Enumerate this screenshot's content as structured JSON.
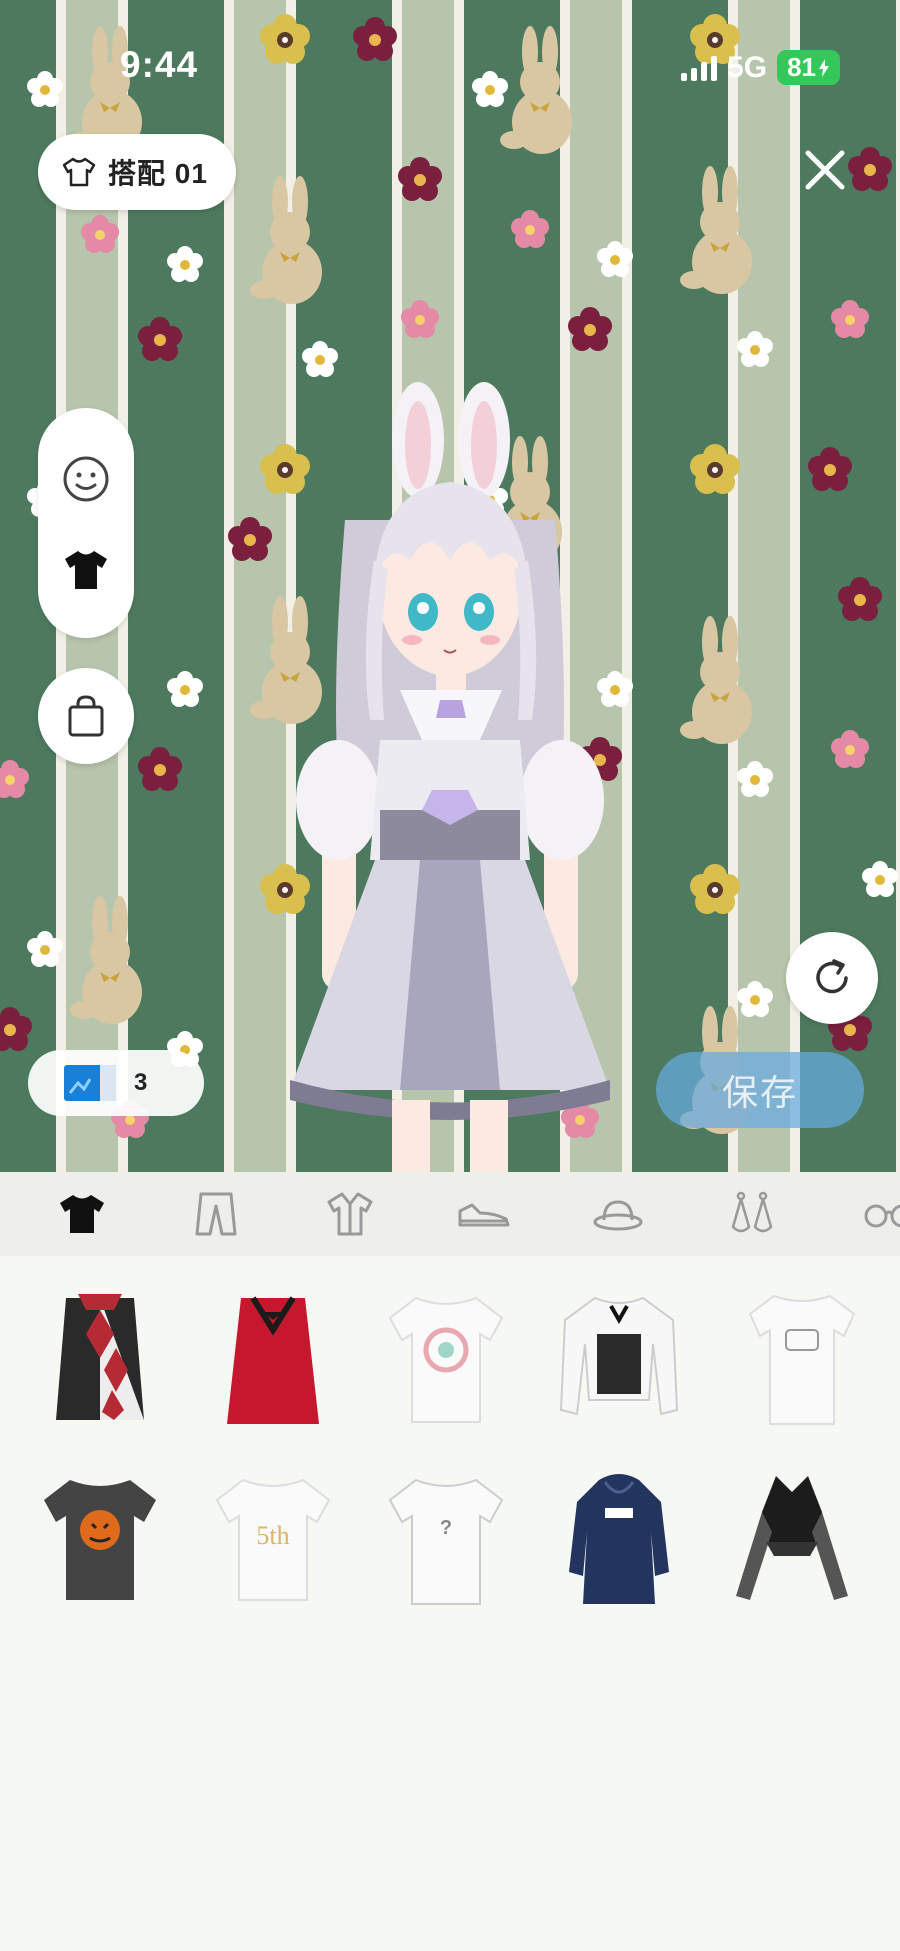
{
  "status_bar": {
    "time": "9:44",
    "network": "5G",
    "battery": "81"
  },
  "outfit": {
    "label": "搭配 01"
  },
  "tickets": {
    "count": "3"
  },
  "save_button": {
    "label": "保存"
  },
  "categories": [
    {
      "id": "tops",
      "icon": "tshirt-icon",
      "selected": true
    },
    {
      "id": "bottoms",
      "icon": "pants-icon",
      "selected": false
    },
    {
      "id": "outerwear",
      "icon": "jacket-icon",
      "selected": false
    },
    {
      "id": "shoes",
      "icon": "sneaker-icon",
      "selected": false
    },
    {
      "id": "hats",
      "icon": "hat-icon",
      "selected": false
    },
    {
      "id": "earrings",
      "icon": "earrings-icon",
      "selected": false
    },
    {
      "id": "glasses",
      "icon": "glasses-icon",
      "selected": false
    }
  ],
  "items": [
    {
      "kind": "harlequin-sleeveless-top",
      "colors": [
        "#2a2a2a",
        "#b52a35",
        "#f0f0f0"
      ]
    },
    {
      "kind": "red-tuxedo-dress",
      "colors": [
        "#c5182e",
        "#1a1a1a"
      ]
    },
    {
      "kind": "white-graphic-tshirt",
      "colors": [
        "#fafafa",
        "#e9a7b0"
      ]
    },
    {
      "kind": "white-blouse-black-corset",
      "colors": [
        "#f7f7f7",
        "#2a2a2a"
      ]
    },
    {
      "kind": "white-long-tshirt",
      "colors": [
        "#fafafa",
        "#999999"
      ]
    },
    {
      "kind": "gray-pumpkin-tshirt",
      "colors": [
        "#444444",
        "#e06a1b"
      ]
    },
    {
      "kind": "white-5th-anniversary-tshirt",
      "colors": [
        "#fafafa",
        "#d9b56a"
      ],
      "print_text": "5th"
    },
    {
      "kind": "white-mystery-tshirt",
      "colors": [
        "#fafafa",
        "#888888"
      ],
      "print_text": "?"
    },
    {
      "kind": "navy-hoodie-dress",
      "colors": [
        "#23355e",
        "#ffffff"
      ]
    },
    {
      "kind": "black-lace-halter-top",
      "colors": [
        "#1c1c1c",
        "#555555"
      ]
    }
  ],
  "colors": {
    "wall_dark": "#4d7a5f",
    "wall_light": "#b7c5ac",
    "accent_blue": "#66aae1",
    "battery_green": "#34c759"
  }
}
